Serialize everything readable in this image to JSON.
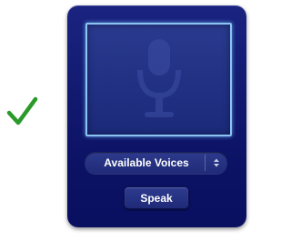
{
  "status": {
    "icon": "checkmark-icon",
    "color": "#2a9a2a"
  },
  "widget": {
    "display": {
      "icon": "microphone-icon"
    },
    "voice_select": {
      "selected_label": "Available Voices",
      "icon": "up-down-arrows-icon"
    },
    "speak_label": "Speak"
  }
}
